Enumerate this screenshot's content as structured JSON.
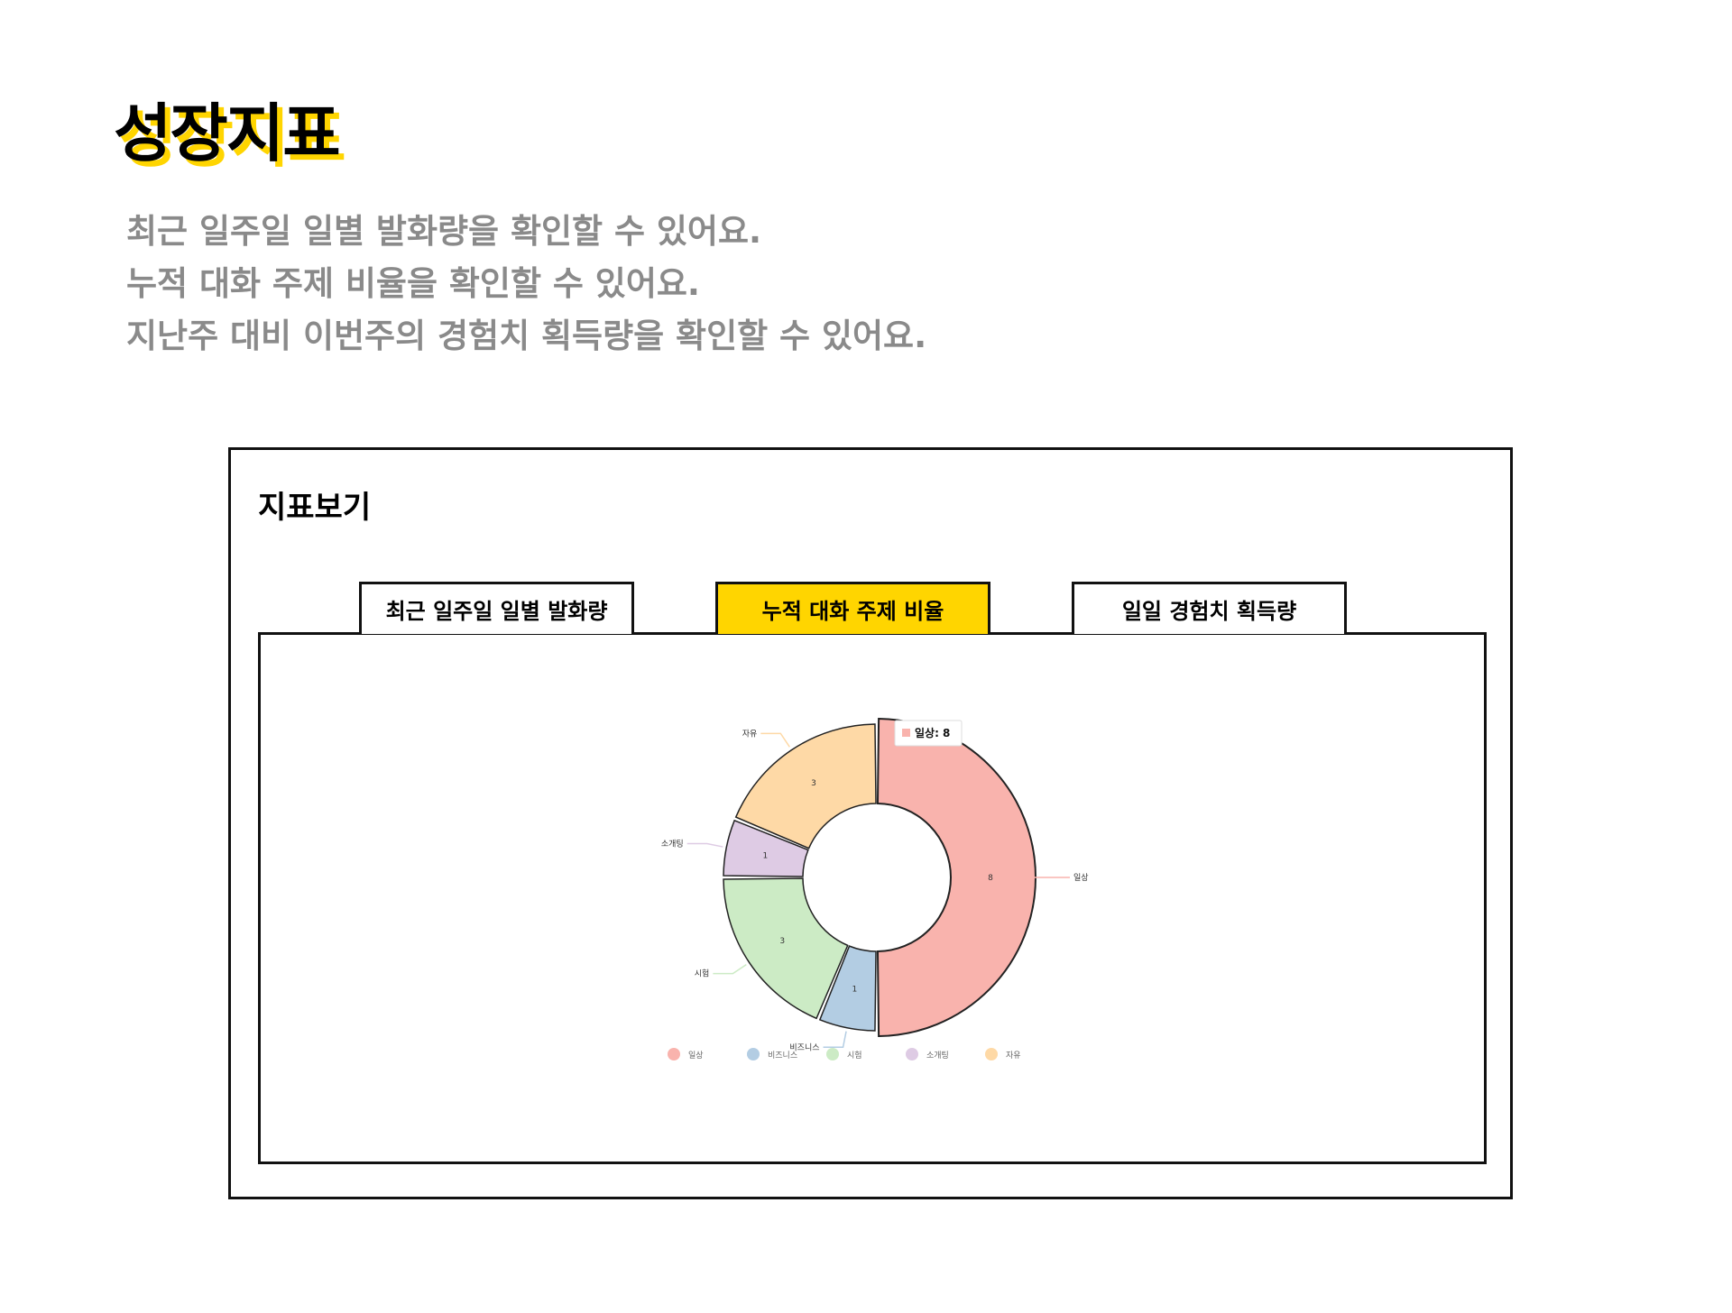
{
  "page": {
    "title": "성장지표",
    "descriptions": [
      "최근 일주일 일별 발화량을 확인할 수 있어요.",
      "누적 대화 주제 비율을 확인할 수 있어요.",
      "지난주 대비 이번주의 경험치 획득량을 확인할 수 있어요."
    ]
  },
  "panel": {
    "title": "지표보기",
    "tabs": [
      {
        "label": "최근 일주일 일별 발화량",
        "active": false
      },
      {
        "label": "누적 대화 주제 비율",
        "active": true
      },
      {
        "label": "일일 경험치 획득량",
        "active": false
      }
    ]
  },
  "colors": {
    "accent": "#FFD500",
    "description_text": "#8a8a8a",
    "border": "#111111"
  },
  "tooltip": {
    "label": "일상",
    "value": "8",
    "text": "일상: 8"
  },
  "chart_data": {
    "type": "pie",
    "variant": "donut",
    "categories": [
      "일상",
      "비즈니스",
      "시험",
      "소개팅",
      "자유"
    ],
    "values": [
      8,
      1,
      3,
      1,
      3
    ],
    "colors": [
      "#F9B3AD",
      "#B3CDE3",
      "#CCEBC5",
      "#DECBE4",
      "#FED9A6"
    ],
    "highlighted": "일상",
    "legend": "bottom"
  }
}
